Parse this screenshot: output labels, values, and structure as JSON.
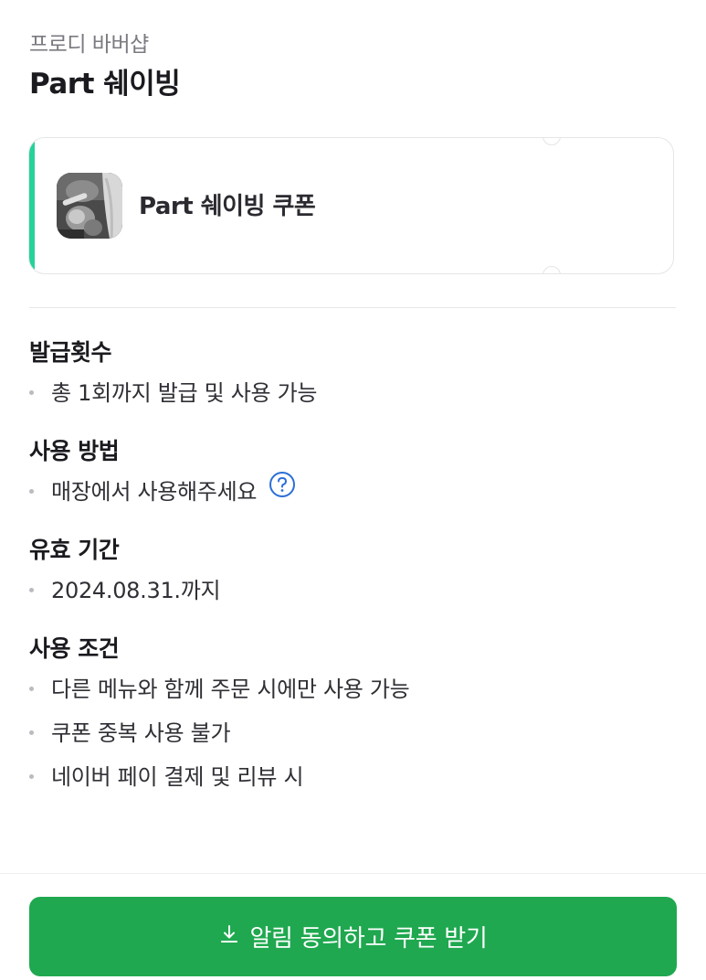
{
  "header": {
    "shop_name": "프로디 바버샵",
    "title": "Part 쉐이빙"
  },
  "coupon": {
    "name": "Part 쉐이빙 쿠폰",
    "accent_color": "#27d19a",
    "thumbnail": "barber-shaving-photo"
  },
  "sections": [
    {
      "title": "발급횟수",
      "items": [
        "총 1회까지 발급 및 사용 가능"
      ]
    },
    {
      "title": "사용 방법",
      "items": [
        "매장에서 사용해주세요"
      ]
    },
    {
      "title": "유효 기간",
      "items": [
        "2024.08.31.까지"
      ]
    },
    {
      "title": "사용 조건",
      "items": [
        "다른 메뉴와 함께 주문 시에만 사용 가능",
        "쿠폰 중복 사용 불가",
        "네이버 페이 결제 및 리뷰 시"
      ]
    }
  ],
  "help_icon": "question-circle-icon",
  "cta": {
    "label": "알림 동의하고 쿠폰 받기",
    "icon": "download-icon",
    "color": "#1fa84f"
  }
}
